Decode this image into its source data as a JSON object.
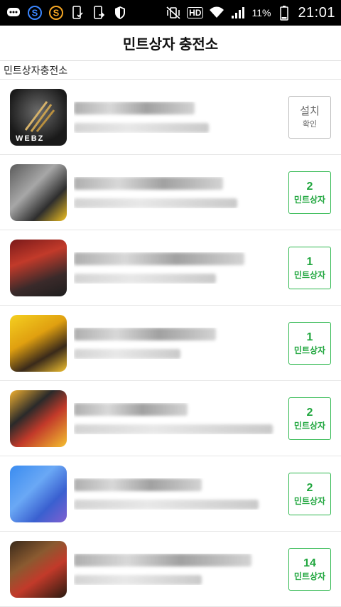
{
  "status_bar": {
    "battery_text": "11%",
    "time": "21:01",
    "hd_badge": "HD",
    "left_icons": [
      "chat-icon",
      "samsung-s-icon",
      "s-icon",
      "phone-check-icon",
      "phone-exit-icon",
      "shield-icon"
    ],
    "right_icons": [
      "vibrate-mute-icon",
      "wifi-icon",
      "signal-icon",
      "battery-icon"
    ]
  },
  "header": {
    "title": "민트상자 충전소"
  },
  "section": {
    "label": "민트상자충전소"
  },
  "colors": {
    "accent": "#2eb84e",
    "install_border": "#bdbdbd"
  },
  "items": [
    {
      "icon": "game-webzen-icon",
      "icon_label": "WEBZ",
      "button_top": "설치",
      "button_bottom": "확인",
      "type": "install"
    },
    {
      "icon": "game-thumb-2",
      "button_top": "2",
      "button_bottom": "민트상자",
      "type": "reward"
    },
    {
      "icon": "game-thumb-3",
      "button_top": "1",
      "button_bottom": "민트상자",
      "type": "reward"
    },
    {
      "icon": "game-thumb-4",
      "button_top": "1",
      "button_bottom": "민트상자",
      "type": "reward"
    },
    {
      "icon": "game-thumb-5",
      "button_top": "2",
      "button_bottom": "민트상자",
      "type": "reward"
    },
    {
      "icon": "game-thumb-6",
      "button_top": "2",
      "button_bottom": "민트상자",
      "type": "reward"
    },
    {
      "icon": "game-thumb-7",
      "button_top": "14",
      "button_bottom": "민트상자",
      "type": "reward"
    }
  ]
}
